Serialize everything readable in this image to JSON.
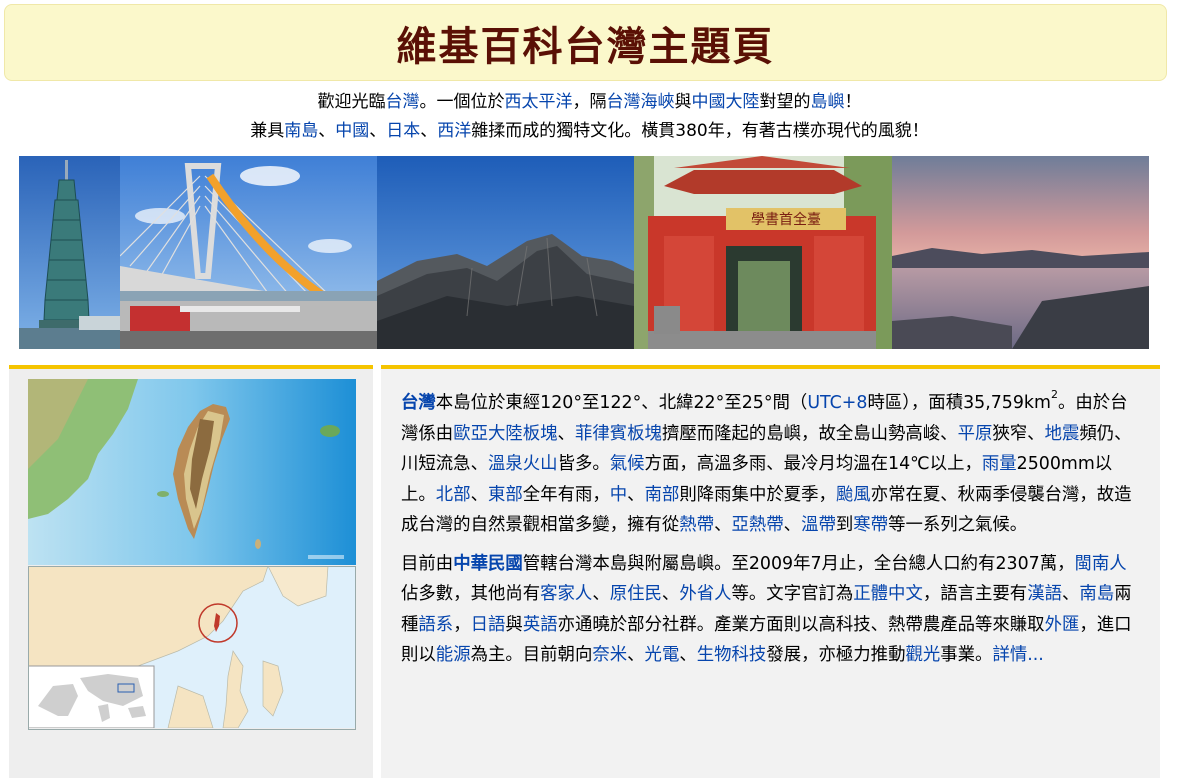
{
  "banner": {
    "title": "維基百科台灣主題頁"
  },
  "welcome": {
    "line1": {
      "t1": "歡迎光臨",
      "l1": "台灣",
      "t2": "。一個位於",
      "l2": "西太平洋",
      "t3": "，隔",
      "l3": "台灣海峽",
      "t4": "與",
      "l4": "中國大陸",
      "t5": "對望的",
      "l5": "島嶼",
      "t6": "！"
    },
    "line2": {
      "t1": "兼具",
      "l1": "南島",
      "t2": "、",
      "l2": "中國",
      "t3": "、",
      "l3": "日本",
      "t4": "、",
      "l4": "西洋",
      "t5": "雜揉而成的獨特文化。橫貫380年，有著古樸亦現代的風貌！"
    }
  },
  "photos": [
    {
      "id": "taipei-101"
    },
    {
      "id": "bridge"
    },
    {
      "id": "mountain"
    },
    {
      "id": "temple-gate",
      "sign": "學書首全臺"
    },
    {
      "id": "lake-sunset"
    }
  ],
  "article": {
    "p1": {
      "s1": "台灣",
      "s2": "本島位於東經120°至122°、北緯22°至25°間（",
      "s3": "UTC+8",
      "s4": "時區），面積35,759km",
      "s5": "2",
      "s6": "。由於台灣係由",
      "s7": "歐亞大陸板塊",
      "s8": "、",
      "s9": "菲律賓板塊",
      "s10": "擠壓而隆起的島嶼，故全島山勢高峻、",
      "s11": "平原",
      "s12": "狹窄、",
      "s13": "地震",
      "s14": "頻仍、川短流急、",
      "s15": "溫泉",
      "s16": "火山",
      "s17": "皆多。",
      "s18": "氣候",
      "s19": "方面，高溫多雨、最冷月均溫在14℃以上，",
      "s20": "雨量",
      "s21": "2500mm以上。",
      "s22": "北部",
      "s23": "、",
      "s24": "東部",
      "s25": "全年有雨，",
      "s26": "中",
      "s27": "、",
      "s28": "南部",
      "s29": "則降雨集中於夏季，",
      "s30": "颱風",
      "s31": "亦常在夏、秋兩季侵襲台灣，故造成台灣的自然景觀相當多變，擁有從",
      "s32": "熱帶",
      "s33": "、",
      "s34": "亞熱帶",
      "s35": "、",
      "s36": "溫帶",
      "s37": "到",
      "s38": "寒帶",
      "s39": "等一系列之氣候。"
    },
    "p2": {
      "s1": "目前由",
      "s2": "中華民國",
      "s3": "管轄台灣本島與附屬島嶼。至2009年7月止，全台總人口約有2307萬，",
      "s4": "閩南人",
      "s5": "佔多數，其他尚有",
      "s6": "客家人",
      "s7": "、",
      "s8": "原住民",
      "s9": "、",
      "s10": "外省人",
      "s11": "等。文字官訂為",
      "s12": "正體中文",
      "s13": "，語言主要有",
      "s14": "漢語",
      "s15": "、",
      "s16": "南島",
      "s17": "兩種",
      "s18": "語系",
      "s19": "，",
      "s20": "日語",
      "s21": "與",
      "s22": "英語",
      "s23": "亦通曉於部分社群。產業方面則以高科技、熱帶農產品等來賺取",
      "s24": "外匯",
      "s25": "，進口則以",
      "s26": "能源",
      "s27": "為主。目前朝向",
      "s28": "奈米",
      "s29": "、",
      "s30": "光電",
      "s31": "、",
      "s32": "生物科技",
      "s33": "發展，亦極力推動",
      "s34": "觀光",
      "s35": "事業。",
      "s36": "詳情..."
    }
  },
  "colors": {
    "banner_bg": "#fbf8cb",
    "title": "#5a1005",
    "link": "#0645ad",
    "divider": "#f5c400"
  }
}
